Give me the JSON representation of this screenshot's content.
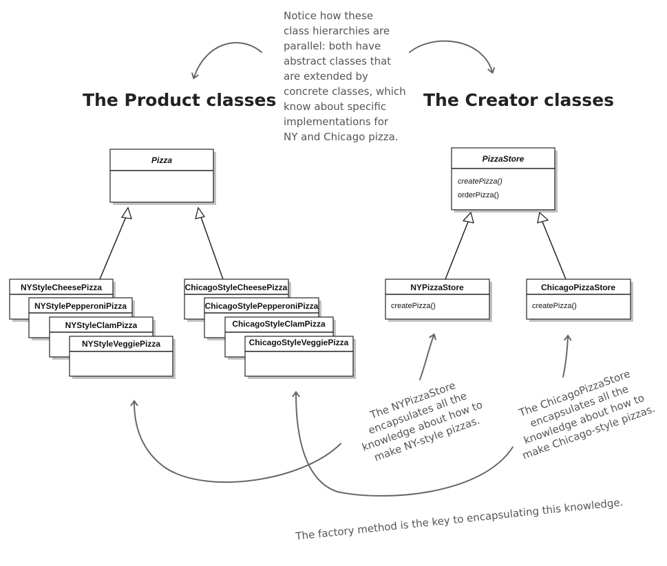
{
  "titles": {
    "product": "The Product classes",
    "creator": "The Creator classes"
  },
  "top_note": [
    "Notice how these",
    "class hierarchies are",
    "parallel: both have",
    "abstract classes that",
    "are extended by",
    "concrete classes, which",
    "know about specific",
    "implementations for",
    "NY and Chicago pizza."
  ],
  "product_classes": {
    "abstract": {
      "name": "Pizza"
    },
    "ny": [
      "NYStyleCheesePizza",
      "NYStylePepperoniPizza",
      "NYStyleClamPizza",
      "NYStyleVeggiePizza"
    ],
    "chicago": [
      "ChicagoStyleCheesePizza",
      "ChicagoStylePepperoniPizza",
      "ChicagoStyleClamPizza",
      "ChicagoStyleVeggiePizza"
    ]
  },
  "creator_classes": {
    "abstract": {
      "name": "PizzaStore",
      "methods": [
        "createPizza()",
        "orderPizza()"
      ]
    },
    "ny": {
      "name": "NYPizzaStore",
      "methods": [
        "createPizza()"
      ]
    },
    "chicago": {
      "name": "ChicagoPizzaStore",
      "methods": [
        "createPizza()"
      ]
    }
  },
  "ny_note": [
    "The NYPizzaStore",
    "encapsulates all the",
    "knowledge about how to",
    "make NY-style pizzas."
  ],
  "chicago_note": [
    "The ChicagoPizzaStore",
    "encapsulates all the",
    "knowledge about how to",
    "make Chicago-style pizzas."
  ],
  "bottom_note": "The factory method is the key to encapsulating this knowledge."
}
